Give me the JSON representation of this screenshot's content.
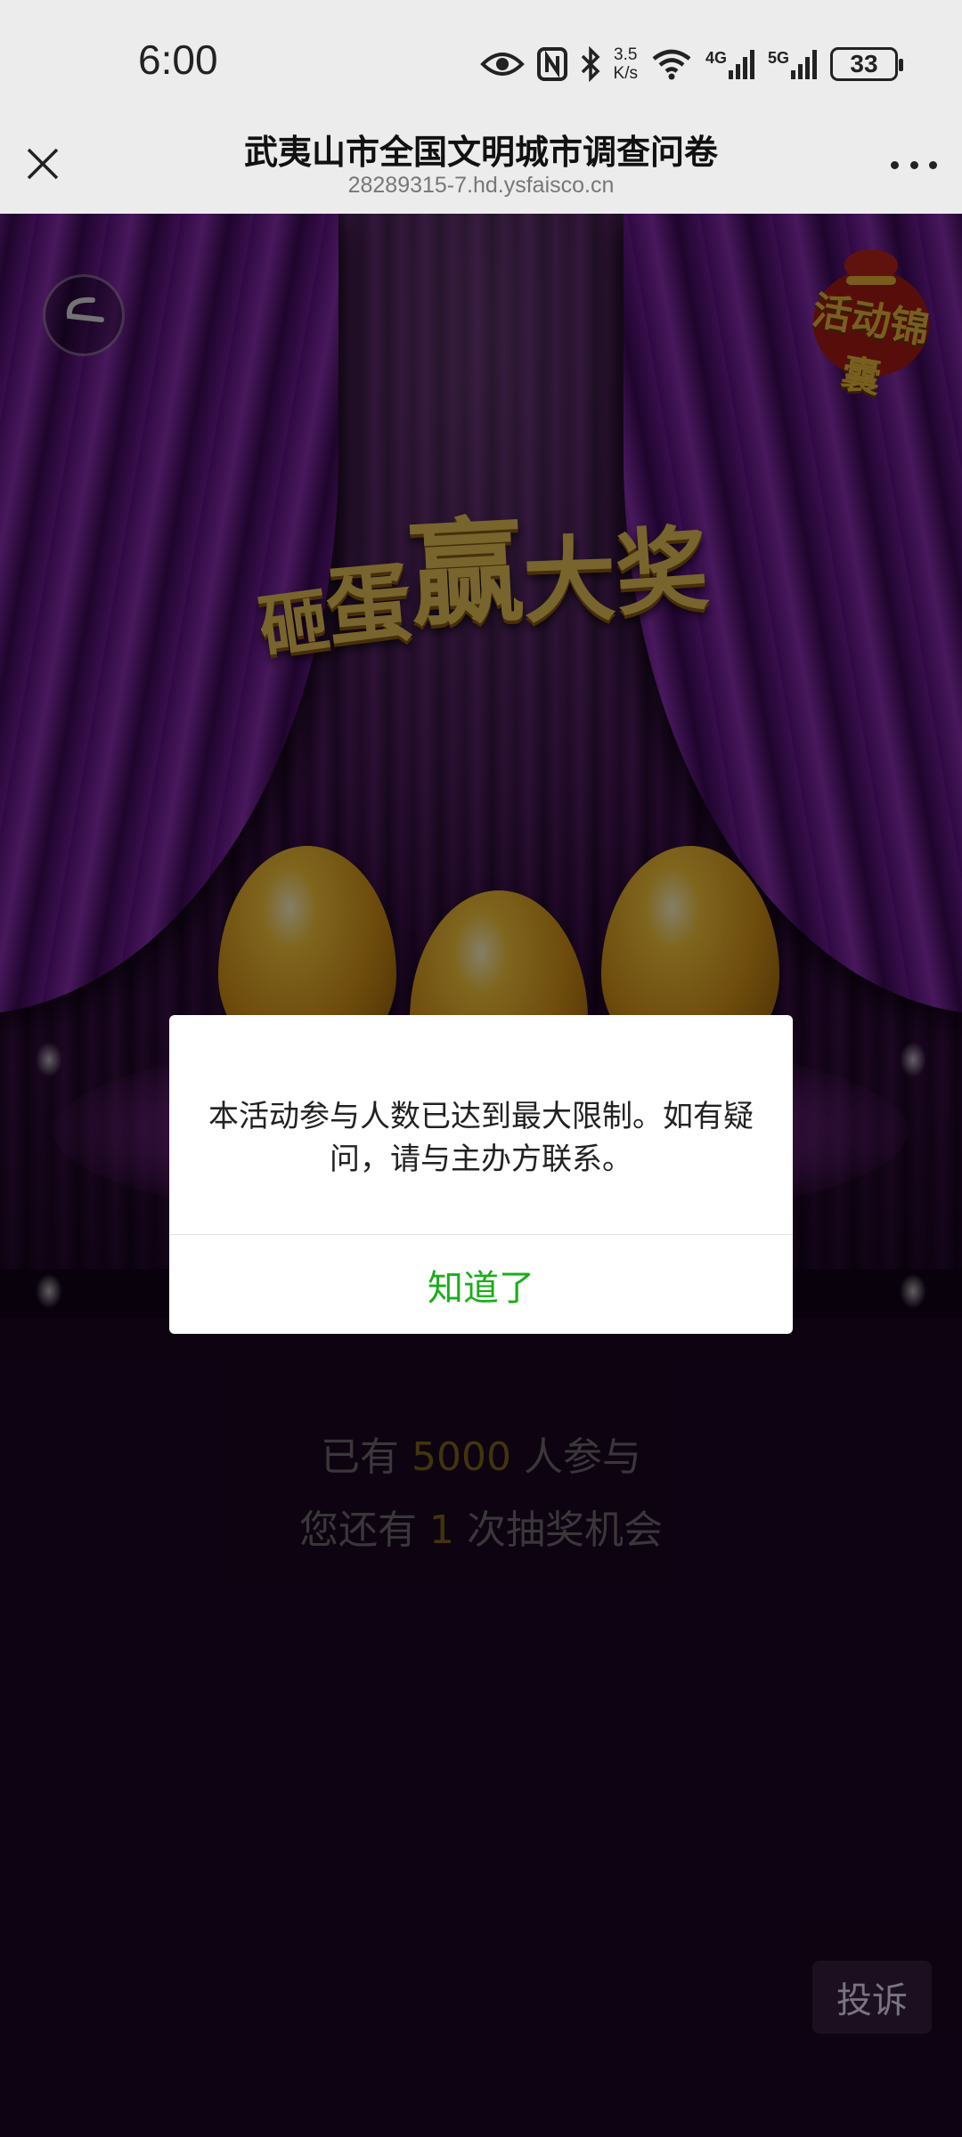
{
  "status_bar": {
    "time": "6:00",
    "net_speed_value": "3.5",
    "net_speed_unit": "K/s",
    "network_4g": "4G",
    "network_5g": "5G",
    "battery": "33"
  },
  "title_bar": {
    "title": "武夷山市全国文明城市调查问卷",
    "url": "28289315-7.hd.ysfaisco.cn"
  },
  "stage": {
    "headline": [
      "砸",
      "蛋",
      "赢",
      "大",
      "奖"
    ],
    "bag_label": "活动锦囊"
  },
  "dialog": {
    "message": "本活动参与人数已达到最大限制。如有疑问，请与主办方联系。",
    "button_label": "知道了"
  },
  "stats": {
    "line1_prefix": "已有",
    "participants": "5000",
    "line1_suffix": "人参与",
    "line2_prefix": "您还有",
    "chances": "1",
    "line2_suffix": "次抽奖机会"
  },
  "complain_label": "投诉",
  "colors": {
    "accent_green": "#1aad19",
    "highlight_gold": "#806716",
    "background": "#1a0622"
  },
  "icons": [
    "close-icon",
    "more-icon",
    "back-icon",
    "eye-icon",
    "nfc-icon",
    "bluetooth-icon",
    "wifi-icon",
    "signal-icon",
    "battery-icon"
  ]
}
